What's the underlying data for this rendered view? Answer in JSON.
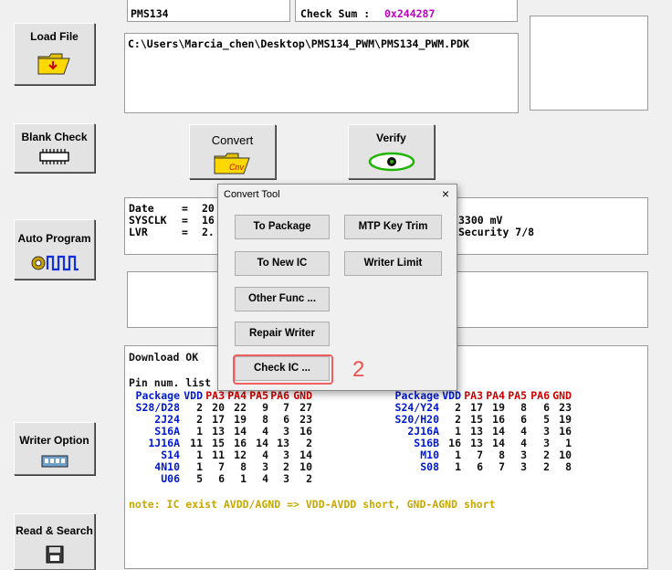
{
  "top": {
    "ic_name": "PMS134",
    "checksum_label": "Check Sum : ",
    "checksum_value": "0x244287",
    "file_path": "C:\\Users\\Marcia_chen\\Desktop\\PMS134_PWM\\PMS134_PWM.PDK"
  },
  "left_buttons": {
    "load_file": "Load File",
    "blank_check": "Blank Check",
    "auto_program": "Auto Program",
    "writer_option": "Writer Option",
    "read_search": "Read & Search"
  },
  "center_buttons": {
    "convert": "Convert",
    "verify": "Verify"
  },
  "info": {
    "lines": [
      {
        "key": "Date",
        "eq": "=",
        "val": "20"
      },
      {
        "key": "SYSCLK",
        "eq": "=",
        "val": "16"
      },
      {
        "key": "LVR",
        "eq": "=",
        "val": "2."
      }
    ],
    "right_lines": [
      "3300 mV",
      "Security 7/8"
    ]
  },
  "dialog": {
    "title": "Convert Tool",
    "close": "×",
    "buttons": {
      "to_package": "To Package",
      "mtp_key_trim": "MTP Key Trim",
      "to_new_ic": "To New IC",
      "writer_limit": "Writer Limit",
      "other_func": "Other Func ...",
      "repair_writer": "Repair Writer",
      "check_ic": "Check IC ..."
    },
    "step_number": "2"
  },
  "log": {
    "status": "Download OK",
    "pin_title": "Pin num. list",
    "headers": [
      "Package",
      "VDD",
      "PA3",
      "PA4",
      "PA5",
      "PA6",
      "GND"
    ],
    "left_rows": [
      [
        "S28/D28",
        "2",
        "20",
        "22",
        "9",
        "7",
        "27"
      ],
      [
        "2J24",
        "2",
        "17",
        "19",
        "8",
        "6",
        "23"
      ],
      [
        "S16A",
        "1",
        "13",
        "14",
        "4",
        "3",
        "16"
      ],
      [
        "1J16A",
        "11",
        "15",
        "16",
        "14",
        "13",
        "2"
      ],
      [
        "S14",
        "1",
        "11",
        "12",
        "4",
        "3",
        "14"
      ],
      [
        "4N10",
        "1",
        "7",
        "8",
        "3",
        "2",
        "10"
      ],
      [
        "U06",
        "5",
        "6",
        "1",
        "4",
        "3",
        "2"
      ]
    ],
    "right_rows": [
      [
        "S24/Y24",
        "2",
        "17",
        "19",
        "8",
        "6",
        "23"
      ],
      [
        "S20/H20",
        "2",
        "15",
        "16",
        "6",
        "5",
        "19"
      ],
      [
        "2J16A",
        "1",
        "13",
        "14",
        "4",
        "3",
        "16"
      ],
      [
        "S16B",
        "16",
        "13",
        "14",
        "4",
        "3",
        "1"
      ],
      [
        "M10",
        "1",
        "7",
        "8",
        "3",
        "2",
        "10"
      ],
      [
        "S08",
        "1",
        "6",
        "7",
        "3",
        "2",
        "8"
      ]
    ],
    "note": "note: IC exist AVDD/AGND => VDD-AVDD short, GND-AGND short"
  }
}
